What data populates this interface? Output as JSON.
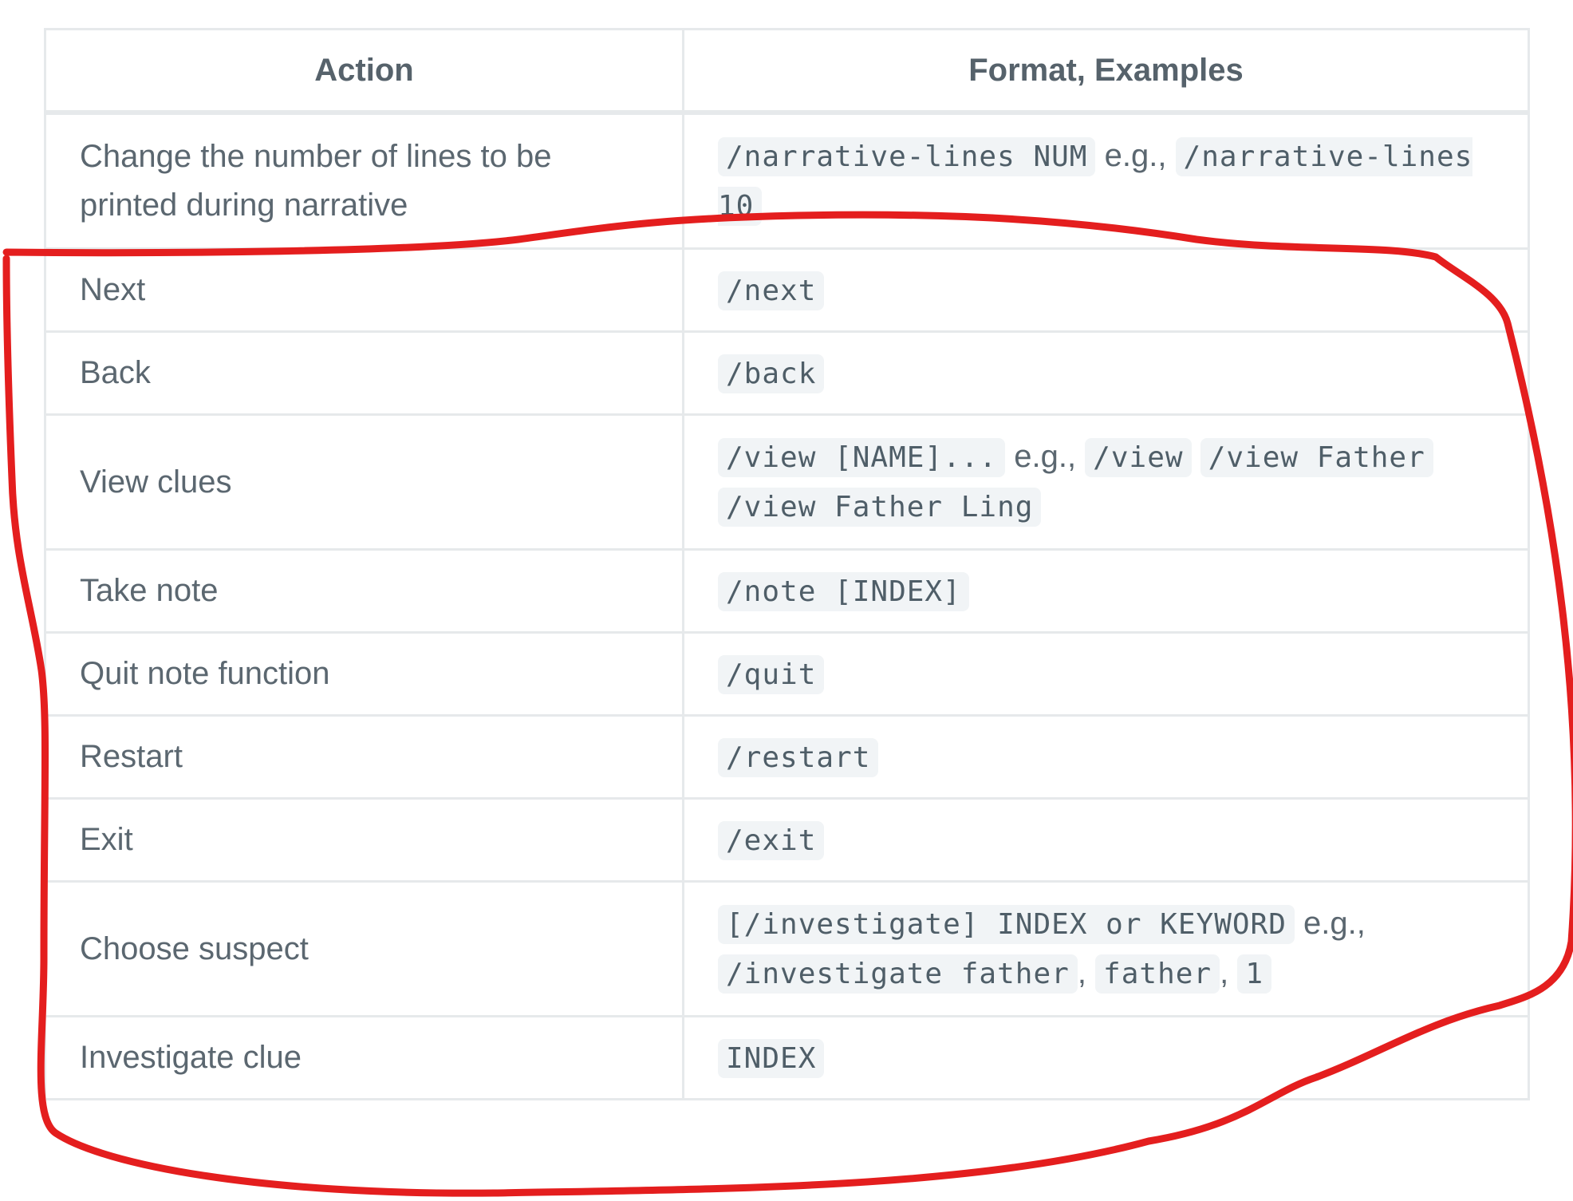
{
  "table": {
    "headers": {
      "action": "Action",
      "format": "Format, Examples"
    },
    "rows": [
      {
        "action": "Change the number of lines to be printed during narrative",
        "format": [
          {
            "type": "code",
            "text": "/narrative-lines NUM"
          },
          {
            "type": "text",
            "text": " e.g., "
          },
          {
            "type": "code",
            "text": "/narrative-lines 10"
          }
        ]
      },
      {
        "action": "Next",
        "format": [
          {
            "type": "code",
            "text": "/next"
          }
        ]
      },
      {
        "action": "Back",
        "format": [
          {
            "type": "code",
            "text": "/back"
          }
        ]
      },
      {
        "action": "View clues",
        "format": [
          {
            "type": "code",
            "text": "/view [NAME]..."
          },
          {
            "type": "text",
            "text": " e.g., "
          },
          {
            "type": "code",
            "text": "/view"
          },
          {
            "type": "text",
            "text": " "
          },
          {
            "type": "code",
            "text": "/view Father"
          },
          {
            "type": "text",
            "text": " "
          },
          {
            "type": "code",
            "text": "/view Father Ling"
          }
        ]
      },
      {
        "action": "Take note",
        "format": [
          {
            "type": "code",
            "text": "/note [INDEX]"
          }
        ]
      },
      {
        "action": "Quit note function",
        "format": [
          {
            "type": "code",
            "text": "/quit"
          }
        ]
      },
      {
        "action": "Restart",
        "format": [
          {
            "type": "code",
            "text": "/restart"
          }
        ]
      },
      {
        "action": "Exit",
        "format": [
          {
            "type": "code",
            "text": "/exit"
          }
        ]
      },
      {
        "action": "Choose suspect",
        "format": [
          {
            "type": "code",
            "text": "[/investigate] INDEX or KEYWORD"
          },
          {
            "type": "text",
            "text": " e.g., "
          },
          {
            "type": "code",
            "text": "/investigate father"
          },
          {
            "type": "text",
            "text": ", "
          },
          {
            "type": "code",
            "text": "father"
          },
          {
            "type": "text",
            "text": ", "
          },
          {
            "type": "code",
            "text": "1"
          }
        ]
      },
      {
        "action": "Investigate clue",
        "format": [
          {
            "type": "code",
            "text": "INDEX"
          }
        ]
      }
    ]
  },
  "colors": {
    "annotation_stroke": "#e41e1e",
    "table_border": "#e6e9eb",
    "code_background": "#f1f4f6",
    "text": "#5b6770"
  }
}
